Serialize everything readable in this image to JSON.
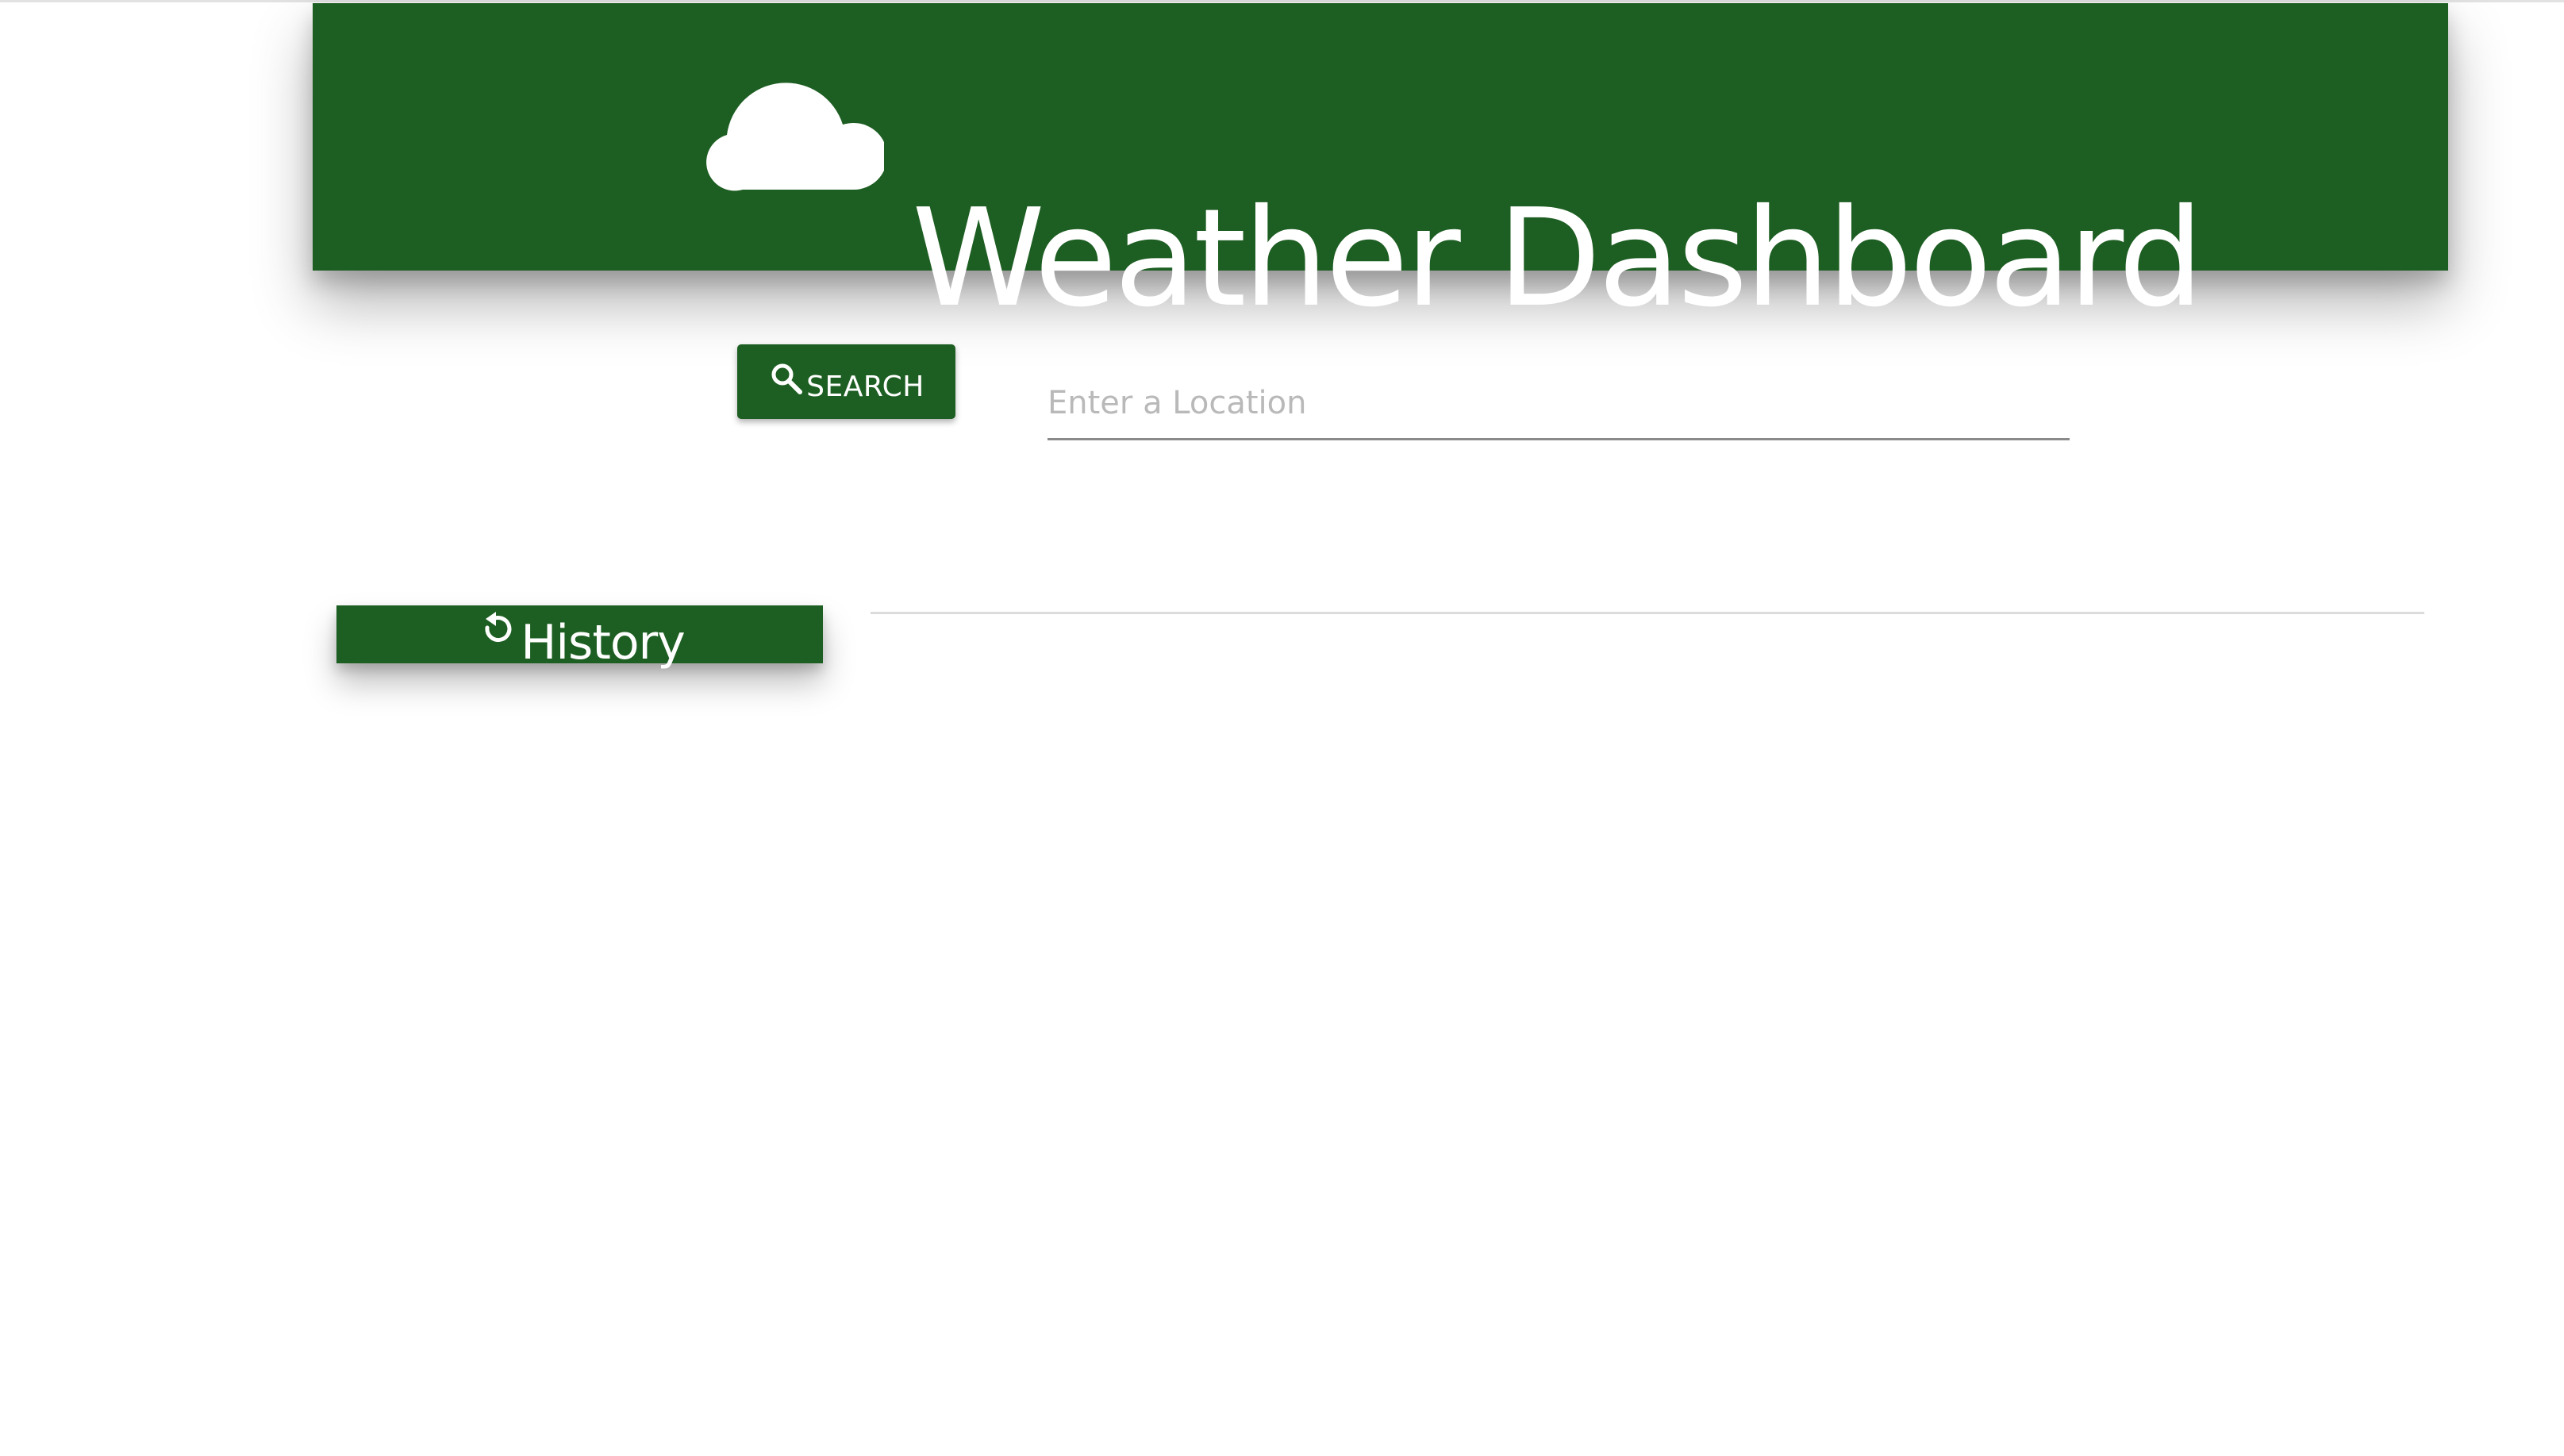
{
  "header": {
    "title": "Weather Dashboard",
    "icon": "cloud-icon"
  },
  "search": {
    "button_label": "SEARCH",
    "button_icon": "search-icon",
    "placeholder": "Enter a Location",
    "value": ""
  },
  "history": {
    "label": "History",
    "icon": "history-icon",
    "items": []
  },
  "colors": {
    "primary": "#1d5e22",
    "text_on_primary": "#ffffff",
    "placeholder": "#b9b9b9",
    "input_underline": "#8a8a8a",
    "divider": "#dcdcdc",
    "background": "#ffffff"
  }
}
